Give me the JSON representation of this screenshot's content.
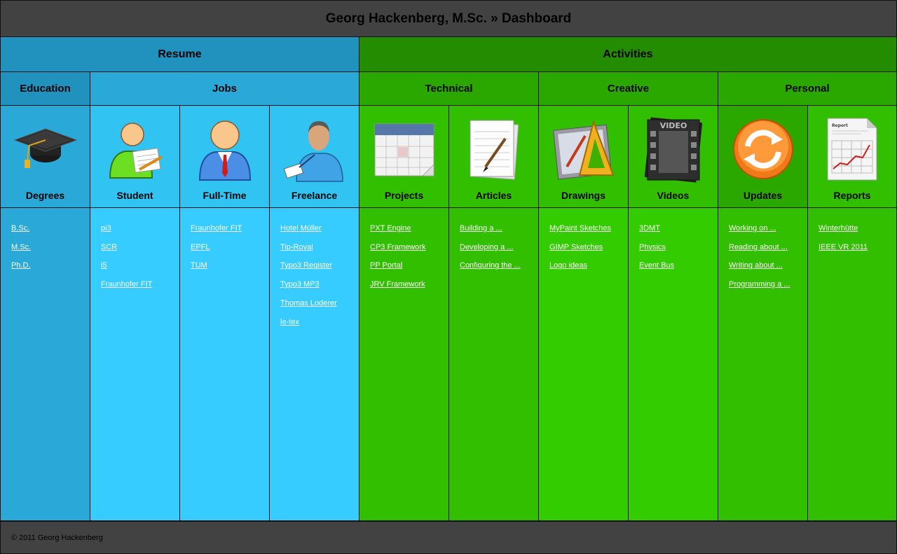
{
  "header": {
    "title": "Georg Hackenberg, M.Sc. » Dashboard"
  },
  "sections": {
    "resume": "Resume",
    "activities": "Activities"
  },
  "groups": {
    "education": "Education",
    "jobs": "Jobs",
    "technical": "Technical",
    "creative": "Creative",
    "personal": "Personal"
  },
  "columns": [
    {
      "label": "Degrees",
      "icon": "graduation-cap-icon",
      "links": [
        "B.Sc.",
        "M.Sc.",
        "Ph.D."
      ]
    },
    {
      "label": "Student",
      "icon": "student-icon",
      "links": [
        "pi3",
        "SCR",
        "i5",
        "Fraunhofer FIT"
      ]
    },
    {
      "label": "Full-Time",
      "icon": "employee-icon",
      "links": [
        "Fraunhofer FIT",
        "EPFL",
        "TUM"
      ]
    },
    {
      "label": "Freelance",
      "icon": "freelancer-icon",
      "links": [
        "Hotel Müller",
        "Tip-Royal",
        "Typo3 Register",
        "Typo3 MP3",
        "Thomas Loderer",
        "le-tex"
      ]
    },
    {
      "label": "Projects",
      "icon": "calendar-icon",
      "links": [
        "PXT Engine",
        "CP3 Framework",
        "PP Portal",
        "JRV Framework"
      ]
    },
    {
      "label": "Articles",
      "icon": "paper-pen-icon",
      "links": [
        "Building a ...",
        "Developing a ...",
        "Configuring the ..."
      ]
    },
    {
      "label": "Drawings",
      "icon": "drawing-tools-icon",
      "links": [
        "MyPaint Sketches",
        "GIMP Sketches",
        "Logo ideas"
      ]
    },
    {
      "label": "Videos",
      "icon": "video-film-icon",
      "badge": "VIDEO",
      "links": [
        "3DMT",
        "Physics",
        "Event Bus"
      ]
    },
    {
      "label": "Updates",
      "icon": "refresh-icon",
      "links": [
        "Working on ...",
        "Reading about ...",
        "Writing about ...",
        "Programming a ..."
      ]
    },
    {
      "label": "Reports",
      "icon": "report-chart-icon",
      "badge": "Report",
      "links": [
        "Winterhütte",
        "IEEE VR 2011"
      ]
    }
  ],
  "footer": {
    "copyright": "© 2011 Georg Hackenberg"
  }
}
